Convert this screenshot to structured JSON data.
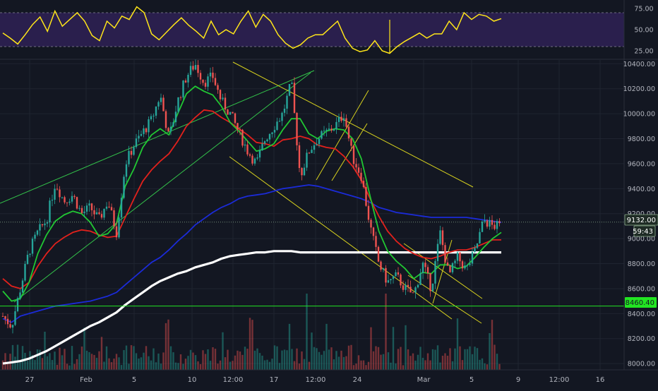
{
  "colors": {
    "background": "#131722",
    "grid": "#1f2430",
    "axis_text": "#b2b5be",
    "up": "#26a69a",
    "down": "#ef5350",
    "rsi_line": "#ffe619",
    "rsi_band": "#2a1f4d",
    "ma_fast": "#21c833",
    "ma_mid": "#e2211c",
    "ma_slow": "#1b2bd8",
    "ma_long": "#ffffff",
    "trend_green": "#33c24a",
    "trend_yellow": "#d8d21e",
    "support_line": "#22e522",
    "price_label_bg": "#1e2b25"
  },
  "rsi_axis": {
    "ticks": [
      "75.00",
      "50.00",
      "25.00"
    ],
    "upper": 70,
    "lower": 30
  },
  "price_axis": {
    "ticks": [
      "10400.00",
      "10200.00",
      "10000.00",
      "9800.00",
      "9600.00",
      "9400.00",
      "9200.00",
      "9000.00",
      "8800.00",
      "8600.00",
      "8400.00",
      "8200.00",
      "8000.00"
    ],
    "current_price": "9132.00",
    "countdown": "59:43",
    "support_label": "8460.40"
  },
  "time_axis": {
    "ticks": [
      "27",
      "Feb",
      "5",
      "10",
      "12:00",
      "17",
      "12:00",
      "24",
      "Mar",
      "5",
      "9",
      "12:00",
      "16"
    ]
  },
  "chart_data": [
    {
      "type": "line",
      "panel": "RSI",
      "ylim": [
        15,
        85
      ],
      "guide_levels": [
        70,
        30
      ],
      "series": [
        {
          "values": [
            46,
            40,
            33,
            44,
            56,
            65,
            48,
            72,
            54,
            62,
            70,
            60,
            43,
            37,
            60,
            52,
            66,
            62,
            77,
            70,
            45,
            38,
            47,
            56,
            64,
            55,
            48,
            40,
            60,
            44,
            50,
            45,
            60,
            72,
            53,
            68,
            60,
            44,
            34,
            28,
            32,
            40,
            44,
            44,
            52,
            60,
            40,
            28,
            24,
            26,
            37,
            25,
            22,
            30,
            36,
            41,
            46,
            40,
            45,
            45,
            60,
            50,
            70,
            62,
            68,
            66,
            60,
            63
          ]
        }
      ]
    },
    {
      "type": "candlestick",
      "panel": "Price",
      "ylim": [
        7950,
        10430
      ],
      "horizontal_levels": [
        9132,
        8460.4
      ],
      "series": [
        {
          "name": "candles",
          "values": [
            8380,
            8300,
            8600,
            8900,
            9050,
            9150,
            9450,
            9300,
            9350,
            9200,
            9250,
            9150,
            9300,
            9050,
            9600,
            9750,
            9850,
            9950,
            10150,
            9800,
            10100,
            10300,
            10400,
            10250,
            10300,
            10100,
            10000,
            9850,
            9700,
            9600,
            9800,
            9900,
            10000,
            10250,
            9500,
            9700,
            9800,
            9850,
            9900,
            10000,
            9650,
            9500,
            9100,
            8800,
            8650,
            8700,
            8600,
            8550,
            8800,
            8600,
            9050,
            8700,
            8850,
            8750,
            8900,
            9150,
            9100,
            9100
          ]
        },
        {
          "name": "ma_fast",
          "values": [
            8580,
            8500,
            8520,
            8650,
            8880,
            9030,
            9140,
            9190,
            9220,
            9200,
            9130,
            9020,
            9040,
            9120,
            9420,
            9560,
            9730,
            9830,
            9880,
            9830,
            10000,
            10160,
            10220,
            10180,
            10150,
            10060,
            9930,
            9860,
            9780,
            9700,
            9720,
            9760,
            9870,
            9960,
            9960,
            9840,
            9800,
            9860,
            9880,
            9870,
            9800,
            9640,
            9340,
            9060,
            8900,
            8820,
            8760,
            8680,
            8730,
            8720,
            8790,
            8790,
            8760,
            8780,
            8850,
            8930,
            9000,
            9050
          ]
        },
        {
          "name": "ma_mid",
          "values": [
            8680,
            8620,
            8600,
            8650,
            8780,
            8880,
            8960,
            9010,
            9050,
            9070,
            9060,
            9030,
            9010,
            9020,
            9170,
            9320,
            9460,
            9550,
            9620,
            9680,
            9780,
            9900,
            9970,
            10030,
            10020,
            9970,
            9930,
            9880,
            9830,
            9770,
            9760,
            9740,
            9790,
            9800,
            9820,
            9800,
            9750,
            9730,
            9720,
            9660,
            9580,
            9470,
            9320,
            9180,
            9060,
            8980,
            8920,
            8880,
            8850,
            8840,
            8860,
            8890,
            8910,
            8910,
            8930,
            8960,
            8990,
            8990
          ]
        },
        {
          "name": "ma_slow",
          "values": [
            8360,
            8330,
            8380,
            8400,
            8420,
            8440,
            8460,
            8470,
            8480,
            8490,
            8500,
            8520,
            8540,
            8570,
            8630,
            8690,
            8750,
            8810,
            8850,
            8910,
            8980,
            9040,
            9110,
            9160,
            9210,
            9250,
            9280,
            9320,
            9340,
            9350,
            9360,
            9380,
            9400,
            9410,
            9420,
            9430,
            9420,
            9400,
            9380,
            9360,
            9340,
            9320,
            9290,
            9250,
            9230,
            9210,
            9200,
            9190,
            9180,
            9170,
            9170,
            9170,
            9170,
            9170,
            9160,
            9150,
            9140,
            9130
          ]
        },
        {
          "name": "ma_long",
          "values": [
            8000,
            8010,
            8020,
            8040,
            8070,
            8100,
            8140,
            8180,
            8220,
            8260,
            8300,
            8330,
            8370,
            8410,
            8470,
            8520,
            8570,
            8620,
            8660,
            8690,
            8720,
            8740,
            8770,
            8790,
            8810,
            8840,
            8860,
            8870,
            8880,
            8890,
            8890,
            8900,
            8900,
            8900,
            8890,
            8890,
            8890,
            8890,
            8890,
            8890,
            8890,
            8890,
            8890,
            8890,
            8890,
            8890,
            8890,
            8890,
            8890,
            8890,
            8890,
            8890,
            8890,
            8890,
            8890,
            8890,
            8890,
            8890
          ]
        }
      ]
    }
  ]
}
